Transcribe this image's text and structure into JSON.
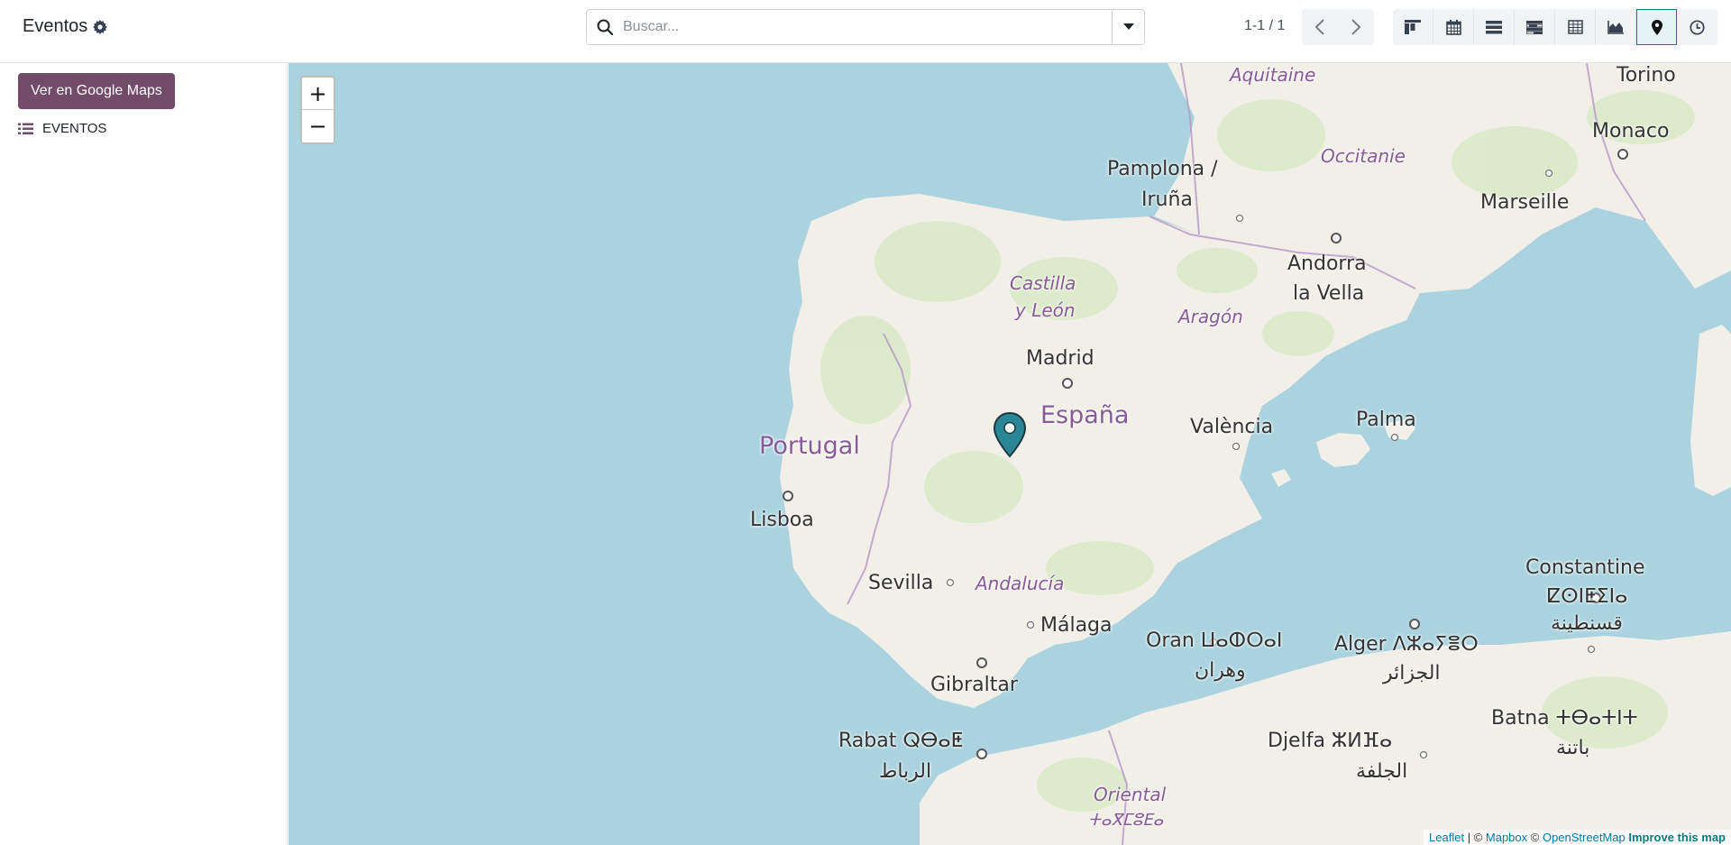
{
  "header": {
    "breadcrumb_title": "Eventos",
    "breadcrumb_icon": "gear-icon"
  },
  "search": {
    "placeholder": "Buscar..."
  },
  "pager": {
    "text": "1-1 / 1"
  },
  "views": [
    {
      "name": "kanban-view",
      "icon": "kanban-icon",
      "active": false
    },
    {
      "name": "calendar-view",
      "icon": "calendar-icon",
      "active": false
    },
    {
      "name": "list-view",
      "icon": "list-icon",
      "active": false
    },
    {
      "name": "gantt-view",
      "icon": "gantt-icon",
      "active": false
    },
    {
      "name": "pivot-view",
      "icon": "pivot-icon",
      "active": false
    },
    {
      "name": "graph-view",
      "icon": "area-chart-icon",
      "active": false
    },
    {
      "name": "map-view",
      "icon": "map-marker-icon",
      "active": true
    },
    {
      "name": "activity-view",
      "icon": "clock-icon",
      "active": false
    }
  ],
  "sidebar": {
    "google_maps_button": "Ver en Google Maps",
    "records_label": "EVENTOS"
  },
  "map": {
    "zoom_in": "+",
    "zoom_out": "−",
    "labels": {
      "aquitaine": "Aquitaine",
      "torino": "Torino",
      "occitanie": "Occitanie",
      "monaco": "Monaco",
      "pamplona": "Pamplona /",
      "iruna": "Iruña",
      "marseille": "Marseille",
      "andorra": "Andorra",
      "la_vella": "la Vella",
      "castilla": "Castilla",
      "y_leon": "y León",
      "aragon": "Aragón",
      "madrid": "Madrid",
      "espana": "España",
      "portugal": "Portugal",
      "valencia": "València",
      "palma": "Palma",
      "lisboa": "Lisboa",
      "sevilla": "Sevilla",
      "andalucia": "Andalucía",
      "constantine": "Constantine",
      "constantine_tif": "ⵇⵙⵏⵟⵉⵏⴰ",
      "constantine_ar": "قسنطينة",
      "malaga": "Málaga",
      "oran": "Oran ⵡⴰⵀⵔⴰⵏ",
      "oran_ar": "وهران",
      "alger": "Alger ⴷⵣⴰⵢⴻⵔ",
      "alger_ar": "الجزائر",
      "gibraltar": "Gibraltar",
      "batna": "Batna ⵜⴱⴰⵜⵏⵜ",
      "batna_ar": "باتنة",
      "rabat": "Rabat ⵕⴱⴰⵟ",
      "rabat_ar": "الرباط",
      "djelfa": "Djelfa ⵣⵍⴼⴰ",
      "djelfa_ar": "الجلفة",
      "oriental": "Oriental",
      "oriental_tif": "ⵜⴰⴳⵎⵓⴹⴰ"
    },
    "attribution": {
      "leaflet": "Leaflet",
      "sep1": " | © ",
      "mapbox": "Mapbox",
      "sep2": " © ",
      "osm": "OpenStreetMap",
      "sep3": " ",
      "improve": "Improve this map"
    }
  },
  "colors": {
    "brand": "#714B67",
    "accent": "#017e84",
    "sea": "#aad3df",
    "land": "#f2efe9",
    "marker": "#2a8694"
  }
}
